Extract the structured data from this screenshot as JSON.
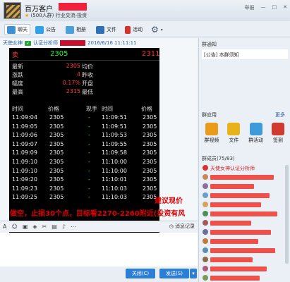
{
  "header": {
    "group_name": "百万客户",
    "sub_members": "(500人群)",
    "sub_category": "行业交流-投资",
    "controls": [
      "举报",
      "—",
      "□",
      "✕"
    ]
  },
  "toolbar": {
    "tabs": [
      {
        "label": "聊天",
        "icon": "chat-icon"
      },
      {
        "label": "公告",
        "icon": "megaphone-icon"
      },
      {
        "label": "相册",
        "icon": "photo-album-icon"
      },
      {
        "label": "文件",
        "icon": "folder-icon"
      },
      {
        "label": "活动",
        "icon": "flag-icon"
      }
    ],
    "settings_icon": "gear-icon"
  },
  "message": {
    "sender": "天使女神",
    "badge": "认证分析师",
    "timestamp": "2016/6/16 11:11:11"
  },
  "quote": {
    "sell_label": "卖",
    "sell_qty": "2305",
    "sell_price": "2311",
    "rows": [
      {
        "k": "最新",
        "v": "2305",
        "k2": "均价"
      },
      {
        "k": "涨跌",
        "v": "4",
        "k2": "昨收"
      },
      {
        "k": "幅度",
        "v": "0.17%",
        "k2": "开盘"
      },
      {
        "k": "最高",
        "v": "2315",
        "k2": "最低"
      }
    ],
    "trade_headers": [
      "时间",
      "价格",
      "现手",
      "时间",
      "价格"
    ],
    "trades": [
      {
        "t1": "11:09:04",
        "p1": "2305",
        "t2": "11:09:51",
        "p2": "2305"
      },
      {
        "t1": "11:09:05",
        "p1": "2305",
        "t2": "11:09:51",
        "p2": "2305"
      },
      {
        "t1": "11:09:06",
        "p1": "2305",
        "t2": "11:09:53",
        "p2": "2305"
      },
      {
        "t1": "11:09:07",
        "p1": "2305",
        "t2": "11:09:55",
        "p2": "2305"
      },
      {
        "t1": "11:09:09",
        "p1": "2305",
        "t2": "11:09:58",
        "p2": "2305"
      },
      {
        "t1": "11:09:10",
        "p1": "2305",
        "t2": "11:10:00",
        "p2": "2305"
      },
      {
        "t1": "11:09:10",
        "p1": "2305",
        "t2": "11:10:00",
        "p2": "2305"
      },
      {
        "t1": "11:09:20",
        "p1": "2305",
        "t2": "11:10:01",
        "p2": "2305"
      },
      {
        "t1": "11:09:23",
        "p1": "2305",
        "t2": "11:10:03",
        "p2": "2305"
      },
      {
        "t1": "11:09:25",
        "p1": "2305",
        "t2": "11:10:03",
        "p2": "2305"
      }
    ]
  },
  "advice": {
    "line1": "建议现价",
    "line2": "做空，止损30个点，目标看2270-2260附近(投资有风"
  },
  "edit_toolbar": {
    "msg_record": "消息记录"
  },
  "buttons": {
    "close": "关闭(C)",
    "send": "发送(S)"
  },
  "right": {
    "notice_title": "群通知",
    "notice_text": "[公告] 本群须知",
    "apps_title": "群应用",
    "apps_more": "更多",
    "apps": [
      {
        "label": "群视频",
        "color": "#e89c1a"
      },
      {
        "label": "文件",
        "color": "#e8b21a"
      },
      {
        "label": "群活动",
        "color": "#3f9bd8"
      },
      {
        "label": "签到",
        "color": "#d13a2e"
      }
    ],
    "members_title": "群成员(75/83)",
    "first_member": "天使女神",
    "first_member_badge": "认证分析师"
  }
}
